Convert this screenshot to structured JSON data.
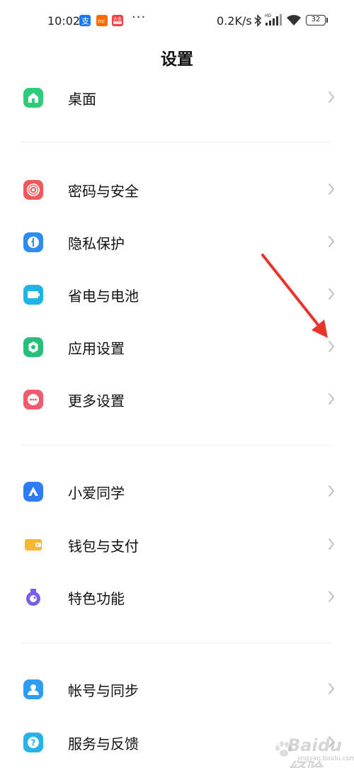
{
  "status_bar": {
    "time": "10:02",
    "notification_dots": "···",
    "network_speed": "0.2K/s",
    "battery": "32",
    "app_icons": [
      "alipay-icon",
      "mi-icon",
      "toutiao-icon"
    ]
  },
  "page": {
    "title": "设置"
  },
  "groups": [
    {
      "items": [
        {
          "label": "桌面",
          "icon": "home-icon",
          "color": "#2DCB7A"
        }
      ]
    },
    {
      "items": [
        {
          "label": "密码与安全",
          "icon": "fingerprint-icon",
          "color": "#F05A5A"
        },
        {
          "label": "隐私保护",
          "icon": "privacy-shield-icon",
          "color": "#2E8CF0"
        },
        {
          "label": "省电与电池",
          "icon": "battery-icon",
          "color": "#1EB4E8"
        },
        {
          "label": "应用设置",
          "icon": "app-gear-icon",
          "color": "#27C07A"
        },
        {
          "label": "更多设置",
          "icon": "more-dots-icon",
          "color": "#EE5C6E"
        }
      ]
    },
    {
      "items": [
        {
          "label": "小爱同学",
          "icon": "xiaoai-icon",
          "color": "#2F7BF5"
        },
        {
          "label": "钱包与支付",
          "icon": "wallet-icon",
          "color": "#F5B82E"
        },
        {
          "label": "特色功能",
          "icon": "features-icon",
          "color": "#7B5CF0"
        }
      ]
    },
    {
      "items": [
        {
          "label": "帐号与同步",
          "icon": "account-icon",
          "color": "#2E9CF0"
        },
        {
          "label": "服务与反馈",
          "icon": "help-icon",
          "color": "#22B5E6"
        }
      ]
    }
  ],
  "annotation": {
    "color": "#E8342A"
  },
  "watermark": {
    "text": "Baidu经验",
    "url": "jingyan.baidu.com"
  }
}
